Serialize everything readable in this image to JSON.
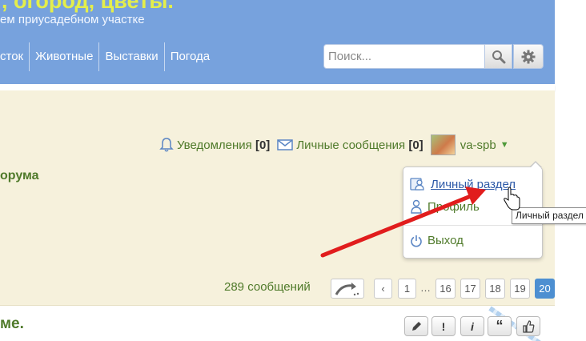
{
  "header": {
    "title": ", огород, цветы.",
    "subtitle": "ем приусадебном участке",
    "nav": [
      "сток",
      "Животные",
      "Выставки",
      "Погода"
    ]
  },
  "search": {
    "placeholder": "Поиск..."
  },
  "userbar": {
    "notifications_label": "Уведомления",
    "notifications_count": "[0]",
    "messages_label": "Личные сообщения",
    "messages_count": "[0]",
    "username": "va-spb"
  },
  "forum_fragment": "орума",
  "dropdown": {
    "items": [
      {
        "label": "Личный раздел",
        "icon": "personal-section-icon",
        "active": true
      },
      {
        "label": "Профиль",
        "icon": "user-profile-icon"
      },
      {
        "label": "Выход",
        "icon": "power-icon"
      }
    ]
  },
  "tooltip": "Личный раздел",
  "pagination": {
    "posts_count": "289 сообщений",
    "prev": "‹",
    "pages": [
      "1",
      "…",
      "16",
      "17",
      "18",
      "19",
      "20"
    ],
    "current": "20"
  },
  "post": {
    "title": "ме.",
    "actions": [
      "edit-icon",
      "!",
      "i",
      "“",
      "like-icon"
    ]
  },
  "colors": {
    "header_bg": "#77a2dd",
    "content_bg": "#f6f1dc",
    "accent_green": "#4f7a2a",
    "page_current": "#4d8fd1",
    "arrow": "#e11d1d"
  }
}
